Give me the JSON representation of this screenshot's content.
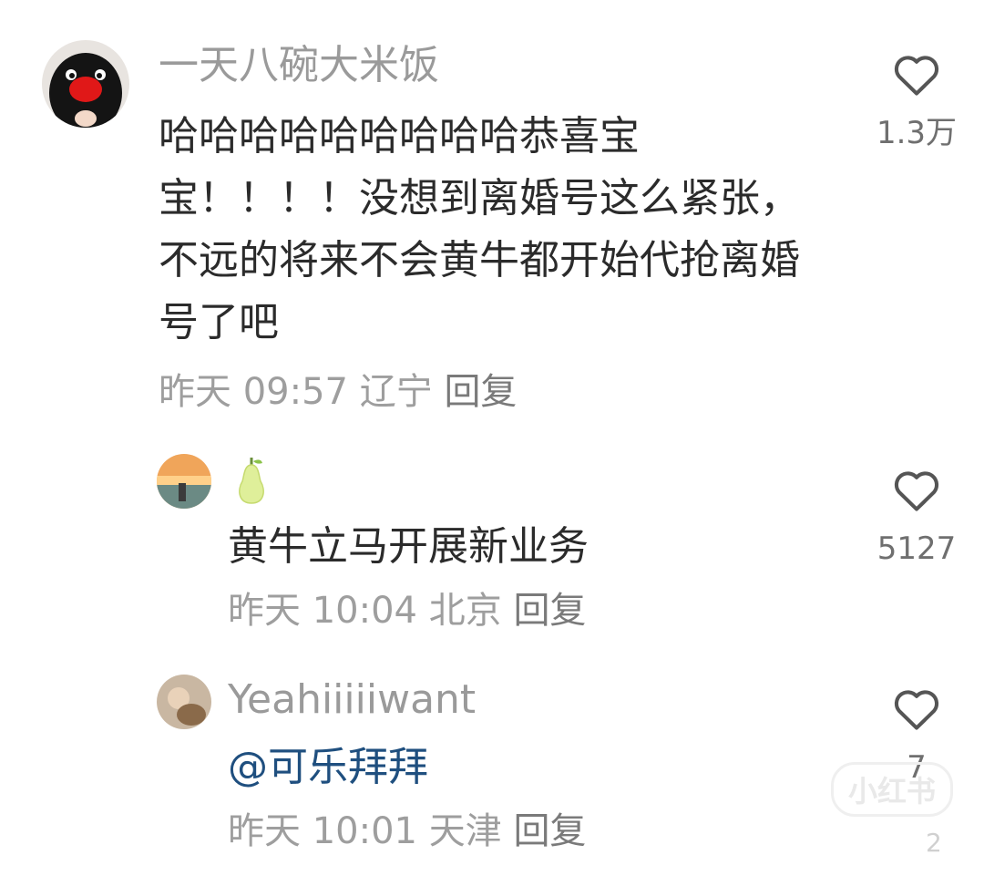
{
  "comments": [
    {
      "username": "一天八碗大米饭",
      "content": "哈哈哈哈哈哈哈哈哈恭喜宝宝！！！！没想到离婚号这么紧张，不远的将来不会黄牛都开始代抢离婚号了吧",
      "time": "昨天 09:57",
      "location": "辽宁",
      "reply_label": "回复",
      "like_count": "1.3万"
    },
    {
      "username": "🍐",
      "content": "黄牛立马开展新业务",
      "time": "昨天 10:04",
      "location": "北京",
      "reply_label": "回复",
      "like_count": "5127"
    },
    {
      "username": "Yeahiiiiiwant",
      "mention": "@可乐拜拜",
      "time": "昨天 10:01",
      "location": "天津",
      "reply_label": "回复",
      "like_count": "7"
    }
  ],
  "watermark": "小红书",
  "corner_number": "2"
}
